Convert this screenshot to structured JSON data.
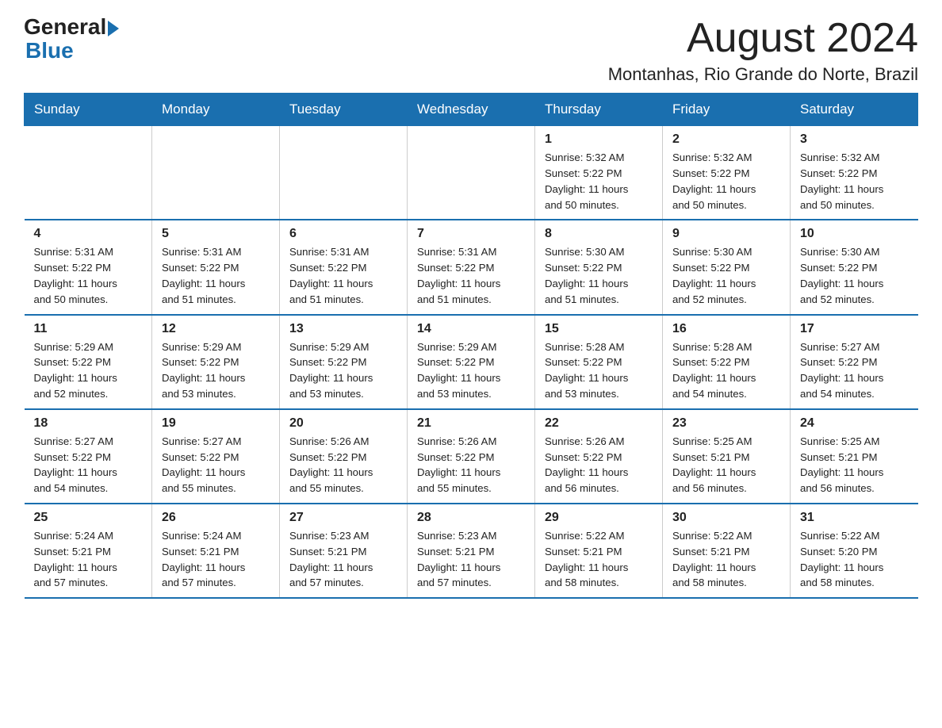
{
  "header": {
    "logo_general": "General",
    "logo_blue": "Blue",
    "month_title": "August 2024",
    "location": "Montanhas, Rio Grande do Norte, Brazil"
  },
  "calendar": {
    "days": [
      "Sunday",
      "Monday",
      "Tuesday",
      "Wednesday",
      "Thursday",
      "Friday",
      "Saturday"
    ],
    "weeks": [
      [
        {
          "day": "",
          "info": ""
        },
        {
          "day": "",
          "info": ""
        },
        {
          "day": "",
          "info": ""
        },
        {
          "day": "",
          "info": ""
        },
        {
          "day": "1",
          "info": "Sunrise: 5:32 AM\nSunset: 5:22 PM\nDaylight: 11 hours\nand 50 minutes."
        },
        {
          "day": "2",
          "info": "Sunrise: 5:32 AM\nSunset: 5:22 PM\nDaylight: 11 hours\nand 50 minutes."
        },
        {
          "day": "3",
          "info": "Sunrise: 5:32 AM\nSunset: 5:22 PM\nDaylight: 11 hours\nand 50 minutes."
        }
      ],
      [
        {
          "day": "4",
          "info": "Sunrise: 5:31 AM\nSunset: 5:22 PM\nDaylight: 11 hours\nand 50 minutes."
        },
        {
          "day": "5",
          "info": "Sunrise: 5:31 AM\nSunset: 5:22 PM\nDaylight: 11 hours\nand 51 minutes."
        },
        {
          "day": "6",
          "info": "Sunrise: 5:31 AM\nSunset: 5:22 PM\nDaylight: 11 hours\nand 51 minutes."
        },
        {
          "day": "7",
          "info": "Sunrise: 5:31 AM\nSunset: 5:22 PM\nDaylight: 11 hours\nand 51 minutes."
        },
        {
          "day": "8",
          "info": "Sunrise: 5:30 AM\nSunset: 5:22 PM\nDaylight: 11 hours\nand 51 minutes."
        },
        {
          "day": "9",
          "info": "Sunrise: 5:30 AM\nSunset: 5:22 PM\nDaylight: 11 hours\nand 52 minutes."
        },
        {
          "day": "10",
          "info": "Sunrise: 5:30 AM\nSunset: 5:22 PM\nDaylight: 11 hours\nand 52 minutes."
        }
      ],
      [
        {
          "day": "11",
          "info": "Sunrise: 5:29 AM\nSunset: 5:22 PM\nDaylight: 11 hours\nand 52 minutes."
        },
        {
          "day": "12",
          "info": "Sunrise: 5:29 AM\nSunset: 5:22 PM\nDaylight: 11 hours\nand 53 minutes."
        },
        {
          "day": "13",
          "info": "Sunrise: 5:29 AM\nSunset: 5:22 PM\nDaylight: 11 hours\nand 53 minutes."
        },
        {
          "day": "14",
          "info": "Sunrise: 5:29 AM\nSunset: 5:22 PM\nDaylight: 11 hours\nand 53 minutes."
        },
        {
          "day": "15",
          "info": "Sunrise: 5:28 AM\nSunset: 5:22 PM\nDaylight: 11 hours\nand 53 minutes."
        },
        {
          "day": "16",
          "info": "Sunrise: 5:28 AM\nSunset: 5:22 PM\nDaylight: 11 hours\nand 54 minutes."
        },
        {
          "day": "17",
          "info": "Sunrise: 5:27 AM\nSunset: 5:22 PM\nDaylight: 11 hours\nand 54 minutes."
        }
      ],
      [
        {
          "day": "18",
          "info": "Sunrise: 5:27 AM\nSunset: 5:22 PM\nDaylight: 11 hours\nand 54 minutes."
        },
        {
          "day": "19",
          "info": "Sunrise: 5:27 AM\nSunset: 5:22 PM\nDaylight: 11 hours\nand 55 minutes."
        },
        {
          "day": "20",
          "info": "Sunrise: 5:26 AM\nSunset: 5:22 PM\nDaylight: 11 hours\nand 55 minutes."
        },
        {
          "day": "21",
          "info": "Sunrise: 5:26 AM\nSunset: 5:22 PM\nDaylight: 11 hours\nand 55 minutes."
        },
        {
          "day": "22",
          "info": "Sunrise: 5:26 AM\nSunset: 5:22 PM\nDaylight: 11 hours\nand 56 minutes."
        },
        {
          "day": "23",
          "info": "Sunrise: 5:25 AM\nSunset: 5:21 PM\nDaylight: 11 hours\nand 56 minutes."
        },
        {
          "day": "24",
          "info": "Sunrise: 5:25 AM\nSunset: 5:21 PM\nDaylight: 11 hours\nand 56 minutes."
        }
      ],
      [
        {
          "day": "25",
          "info": "Sunrise: 5:24 AM\nSunset: 5:21 PM\nDaylight: 11 hours\nand 57 minutes."
        },
        {
          "day": "26",
          "info": "Sunrise: 5:24 AM\nSunset: 5:21 PM\nDaylight: 11 hours\nand 57 minutes."
        },
        {
          "day": "27",
          "info": "Sunrise: 5:23 AM\nSunset: 5:21 PM\nDaylight: 11 hours\nand 57 minutes."
        },
        {
          "day": "28",
          "info": "Sunrise: 5:23 AM\nSunset: 5:21 PM\nDaylight: 11 hours\nand 57 minutes."
        },
        {
          "day": "29",
          "info": "Sunrise: 5:22 AM\nSunset: 5:21 PM\nDaylight: 11 hours\nand 58 minutes."
        },
        {
          "day": "30",
          "info": "Sunrise: 5:22 AM\nSunset: 5:21 PM\nDaylight: 11 hours\nand 58 minutes."
        },
        {
          "day": "31",
          "info": "Sunrise: 5:22 AM\nSunset: 5:20 PM\nDaylight: 11 hours\nand 58 minutes."
        }
      ]
    ]
  }
}
